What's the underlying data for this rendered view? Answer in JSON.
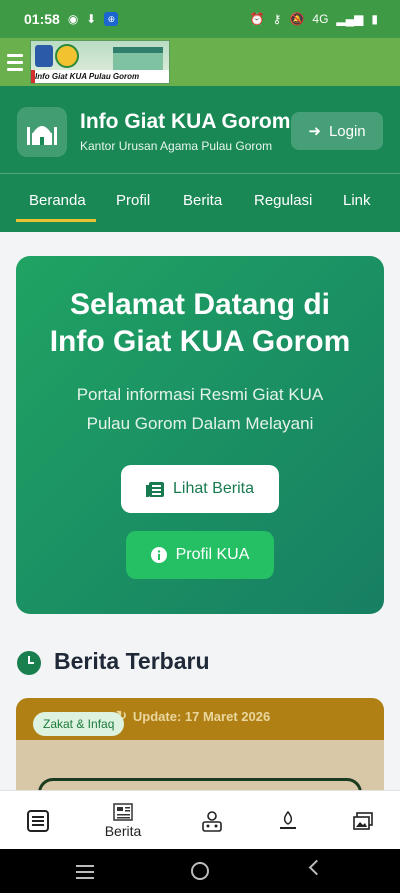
{
  "status_bar": {
    "time": "01:58",
    "network": "4G"
  },
  "banner": {
    "caption": "Info Giat KUA Pulau Gorom"
  },
  "header": {
    "title": "Info Giat KUA Gorom",
    "subtitle": "Kantor Urusan Agama Pulau Gorom",
    "login_label": "Login"
  },
  "nav": {
    "items": [
      "Beranda",
      "Profil",
      "Berita",
      "Regulasi",
      "Link"
    ],
    "active": "Beranda"
  },
  "hero": {
    "title_line1": "Selamat Datang di",
    "title_line2": "Info Giat KUA Gorom",
    "sub_line1": "Portal informasi Resmi Giat KUA",
    "sub_line2": "Pulau Gorom Dalam Melayani",
    "btn_berita": "Lihat Berita",
    "btn_profil": "Profil KUA"
  },
  "section": {
    "title": "Berita Terbaru"
  },
  "news_card": {
    "update": "Update: 17 Maret 2026",
    "tag": "Zakat & Infaq"
  },
  "bottom_nav": {
    "berita_label": "Berita"
  },
  "colors": {
    "primary": "#198855",
    "accent": "#e9c234",
    "status_bar": "#3f9a45",
    "appbar": "#6ab04c"
  }
}
